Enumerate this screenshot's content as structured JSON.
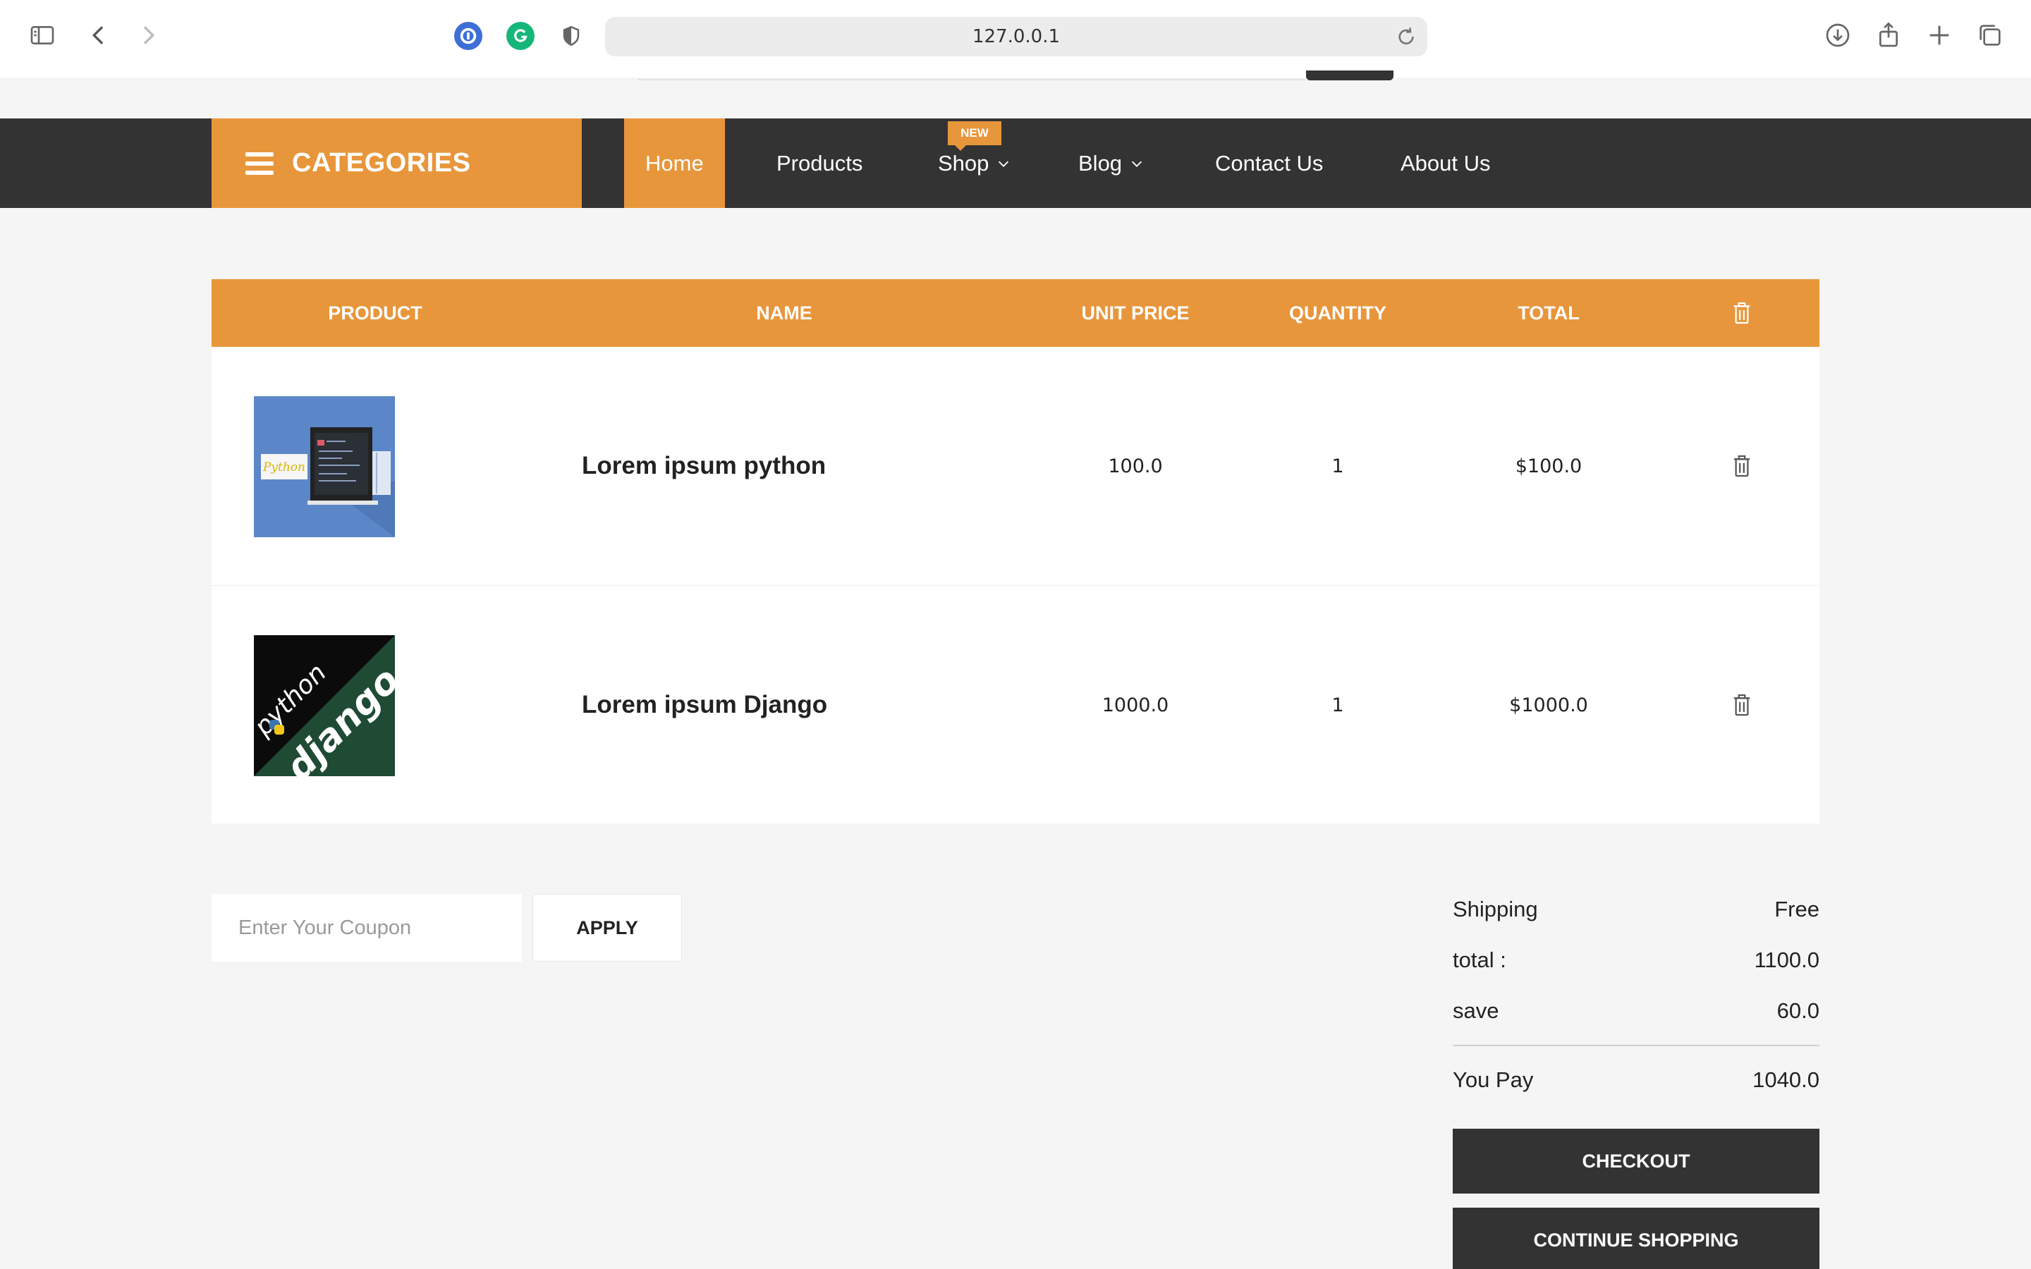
{
  "browser": {
    "url": "127.0.0.1",
    "icons": [
      "sidebar-icon",
      "back-icon",
      "forward-icon",
      "password-manager-icon",
      "grammarly-icon",
      "shield-icon",
      "reload-icon",
      "download-icon",
      "share-icon",
      "new-tab-icon",
      "tabs-overview-icon"
    ]
  },
  "nav": {
    "categories_label": "CATEGORIES",
    "items": [
      {
        "label": "Home"
      },
      {
        "label": "Products"
      },
      {
        "label": "Shop"
      },
      {
        "label": "Blog"
      },
      {
        "label": "Contact Us"
      },
      {
        "label": "About Us"
      }
    ],
    "shop_badge": "NEW"
  },
  "cart": {
    "headers": {
      "product": "PRODUCT",
      "name": "NAME",
      "unit_price": "UNIT PRICE",
      "quantity": "QUANTITY",
      "total": "TOTAL"
    },
    "rows": [
      {
        "name": "Lorem ipsum python",
        "unit_price": "100.0",
        "quantity": "1",
        "total": "$100.0",
        "image": "python-laptop-thumbnail",
        "image_text": "Python"
      },
      {
        "name": "Lorem ipsum Django",
        "unit_price": "1000.0",
        "quantity": "1",
        "total": "$1000.0",
        "image": "python-django-thumbnail",
        "image_text_1": "python",
        "image_text_2": "django"
      }
    ]
  },
  "coupon": {
    "placeholder": "Enter Your Coupon",
    "apply_label": "APPLY"
  },
  "summary": {
    "shipping_label": "Shipping",
    "shipping_value": "Free",
    "total_label": "total :",
    "total_value": "1100.0",
    "save_label": "save",
    "save_value": "60.0",
    "pay_label": "You Pay",
    "pay_value": "1040.0",
    "checkout_label": "CHECKOUT",
    "continue_label": "CONTINUE SHOPPING"
  },
  "colors": {
    "accent": "#e8963b",
    "dark": "#333333",
    "background": "#f5f5f5"
  }
}
